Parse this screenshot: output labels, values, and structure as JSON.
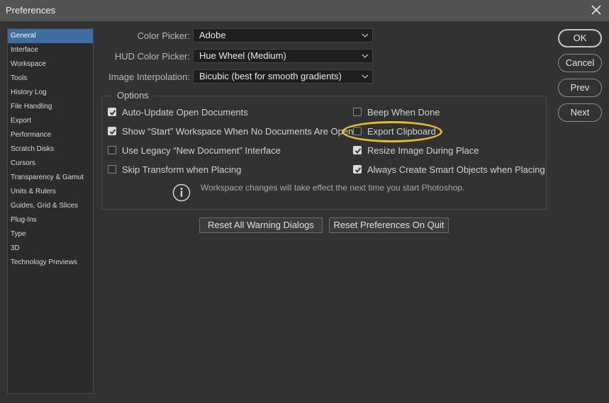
{
  "window": {
    "title": "Preferences"
  },
  "sidebar": {
    "items": [
      {
        "label": "General",
        "active": true
      },
      {
        "label": "Interface"
      },
      {
        "label": "Workspace"
      },
      {
        "label": "Tools"
      },
      {
        "label": "History Log"
      },
      {
        "label": "File Handling"
      },
      {
        "label": "Export"
      },
      {
        "label": "Performance"
      },
      {
        "label": "Scratch Disks"
      },
      {
        "label": "Cursors"
      },
      {
        "label": "Transparency & Gamut"
      },
      {
        "label": "Units & Rulers"
      },
      {
        "label": "Guides, Grid & Slices"
      },
      {
        "label": "Plug-Ins"
      },
      {
        "label": "Type"
      },
      {
        "label": "3D"
      },
      {
        "label": "Technology Previews"
      }
    ]
  },
  "fields": {
    "color_picker": {
      "label": "Color Picker:",
      "value": "Adobe"
    },
    "hud_color_picker": {
      "label": "HUD Color Picker:",
      "value": "Hue Wheel (Medium)"
    },
    "image_interpolation": {
      "label": "Image Interpolation:",
      "value": "Bicubic (best for smooth gradients)"
    }
  },
  "options": {
    "legend": "Options",
    "left": [
      {
        "label": "Auto-Update Open Documents",
        "checked": true
      },
      {
        "label": "Show “Start” Workspace When No Documents Are Open",
        "checked": true
      },
      {
        "label": "Use Legacy “New Document” Interface",
        "checked": false
      },
      {
        "label": "Skip Transform when Placing",
        "checked": false
      }
    ],
    "right": [
      {
        "label": "Beep When Done",
        "checked": false
      },
      {
        "label": "Export Clipboard",
        "checked": false
      },
      {
        "label": "Resize Image During Place",
        "checked": true
      },
      {
        "label": "Always Create Smart Objects when Placing",
        "checked": true
      }
    ],
    "info": "Workspace changes will take effect the next time you start Photoshop."
  },
  "buttons": {
    "reset_warnings": "Reset All Warning Dialogs",
    "reset_prefs": "Reset Preferences On Quit",
    "ok": "OK",
    "cancel": "Cancel",
    "prev": "Prev",
    "next": "Next"
  },
  "colors": {
    "accent_selection": "#3e6ca3",
    "highlight_ring": "#e8b82e"
  },
  "icons": [
    "close-icon",
    "chevron-down-icon",
    "checkmark-icon",
    "info-icon"
  ]
}
